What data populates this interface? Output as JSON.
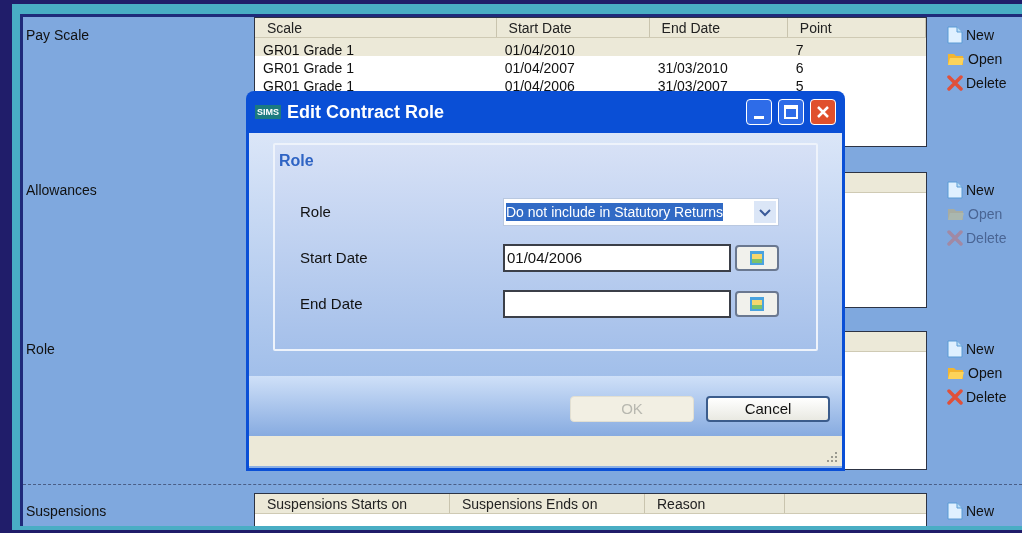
{
  "sections": [
    {
      "label": "Pay Scale",
      "table": {
        "columns": [
          "Scale",
          "Start Date",
          "End Date",
          "Point"
        ],
        "rows": [
          {
            "cells": [
              "GR01 Grade 1",
              "01/04/2010",
              null,
              "7"
            ],
            "selected": true
          },
          {
            "cells": [
              "GR01 Grade 1",
              "01/04/2007",
              "31/03/2010",
              "6"
            ],
            "selected": false
          },
          {
            "cells": [
              "GR01 Grade 1",
              "01/04/2006",
              "31/03/2007",
              "5"
            ],
            "selected": false
          }
        ]
      },
      "actions": [
        {
          "kind": "new",
          "label": "New",
          "disabled": false
        },
        {
          "kind": "open",
          "label": "Open",
          "disabled": false
        },
        {
          "kind": "delete",
          "label": "Delete",
          "disabled": false
        }
      ]
    },
    {
      "label": "Allowances",
      "actions": [
        {
          "kind": "new",
          "label": "New",
          "disabled": false
        },
        {
          "kind": "open",
          "label": "Open",
          "disabled": true
        },
        {
          "kind": "delete",
          "label": "Delete",
          "disabled": true
        }
      ]
    },
    {
      "label": "Role",
      "actions": [
        {
          "kind": "new",
          "label": "New",
          "disabled": false
        },
        {
          "kind": "open",
          "label": "Open",
          "disabled": false
        },
        {
          "kind": "delete",
          "label": "Delete",
          "disabled": false
        }
      ]
    },
    {
      "label": "Suspensions",
      "table": {
        "columns": [
          "Suspensions Starts on",
          "Suspensions Ends on",
          "Reason"
        ]
      },
      "actions": [
        {
          "kind": "new",
          "label": "New",
          "disabled": false
        }
      ]
    }
  ],
  "dialog": {
    "app_badge": "SIMS",
    "title": "Edit Contract Role",
    "group": "Role",
    "fields": [
      {
        "kind": "select",
        "label": "Role",
        "value": "Do not include in Statutory Returns",
        "selected": true
      },
      {
        "kind": "date",
        "label": "Start Date",
        "value": "01/04/2006"
      },
      {
        "kind": "date",
        "label": "End Date"
      }
    ],
    "buttons": [
      {
        "label": "OK",
        "disabled": true
      },
      {
        "label": "Cancel",
        "disabled": false
      }
    ]
  }
}
